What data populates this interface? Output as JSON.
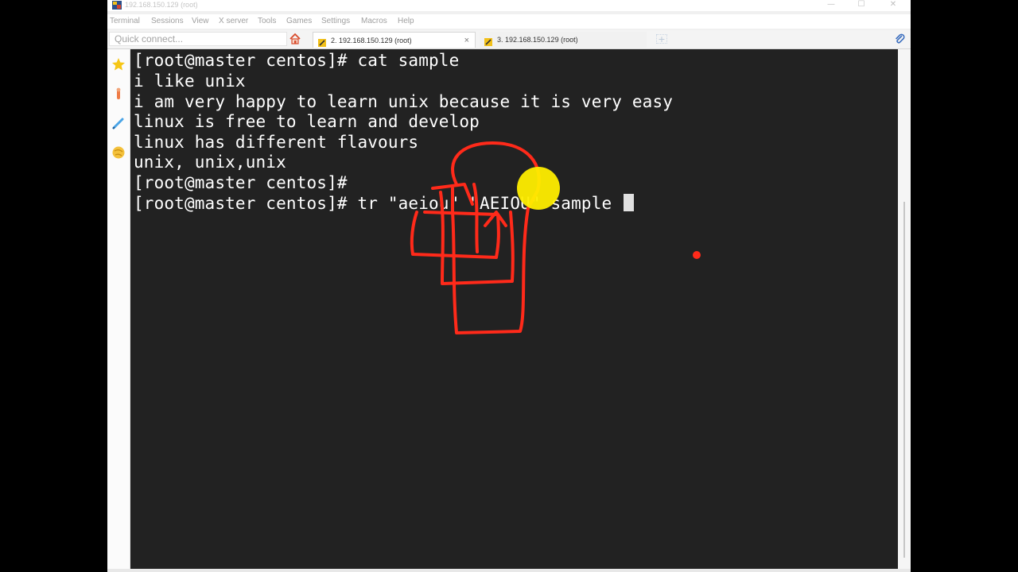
{
  "window": {
    "title": "192.168.150.129 (root)",
    "controls": {
      "minimize": "—",
      "maximize": "☐",
      "close": "✕"
    }
  },
  "menu": [
    "Terminal",
    "Sessions",
    "View",
    "X server",
    "Tools",
    "Games",
    "Settings",
    "Macros",
    "Help"
  ],
  "quick_connect": {
    "placeholder": "Quick connect..."
  },
  "tabs": [
    {
      "label": "2. 192.168.150.129 (root)",
      "active": true,
      "close": "×"
    },
    {
      "label": "3. 192.168.150.129 (root)",
      "active": false
    }
  ],
  "new_tab_symbol": "+",
  "sidebar_icons": [
    "star-icon",
    "tools-icon",
    "pen-icon",
    "globe-icon"
  ],
  "terminal": {
    "lines": [
      "[root@master centos]# cat sample",
      "i like unix",
      "i am very happy to learn unix because it is very easy",
      "linux is free to learn and develop",
      "linux has different flavours",
      "unix, unix,unix",
      "[root@master centos]#",
      "[root@master centos]# tr \"aeiou\" \"AEIOU\" sample "
    ],
    "background": "#222222",
    "foreground": "#ffffff"
  },
  "annotation": {
    "stroke_color": "#ff2a1a",
    "highlight_color": "#ffee00"
  }
}
